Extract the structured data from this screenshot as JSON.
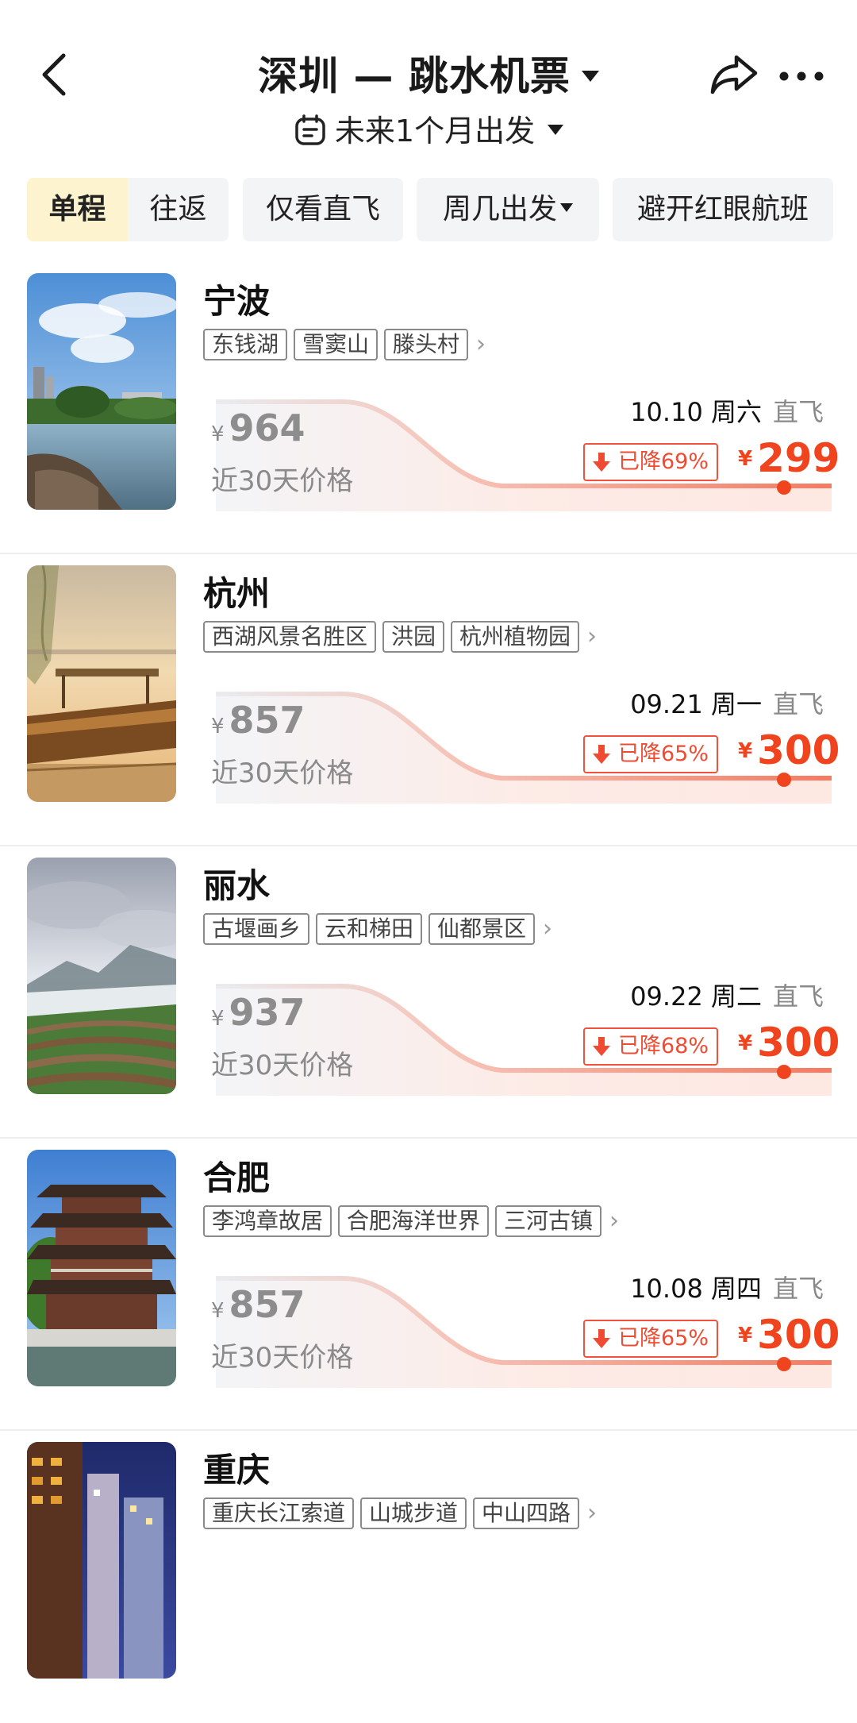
{
  "header": {
    "title": "深圳 — 跳水机票",
    "subtitle": "未来1个月出发"
  },
  "filters": {
    "trip_types": [
      "单程",
      "往返"
    ],
    "active_trip_type": "单程",
    "direct_only": "仅看直飞",
    "weekday": "周几出发",
    "avoid_redeye": "避开红眼航班"
  },
  "list": [
    {
      "city": "宁波",
      "tags": [
        "东钱湖",
        "雪窦山",
        "滕头村"
      ],
      "ref_currency": "¥",
      "ref_price": "964",
      "ref_label": "近30天价格",
      "date": "10.10",
      "weekday": "周六",
      "flight_type": "直飞",
      "drop": "已降69%",
      "currency": "¥",
      "price": "299",
      "image": "lake-landscape"
    },
    {
      "city": "杭州",
      "tags": [
        "西湖风景名胜区",
        "洪园",
        "杭州植物园"
      ],
      "ref_currency": "¥",
      "ref_price": "857",
      "ref_label": "近30天价格",
      "date": "09.21",
      "weekday": "周一",
      "flight_type": "直飞",
      "drop": "已降65%",
      "currency": "¥",
      "price": "300",
      "image": "sunset-boat"
    },
    {
      "city": "丽水",
      "tags": [
        "古堰画乡",
        "云和梯田",
        "仙都景区"
      ],
      "ref_currency": "¥",
      "ref_price": "937",
      "ref_label": "近30天价格",
      "date": "09.22",
      "weekday": "周二",
      "flight_type": "直飞",
      "drop": "已降68%",
      "currency": "¥",
      "price": "300",
      "image": "terraced-fields"
    },
    {
      "city": "合肥",
      "tags": [
        "李鸿章故居",
        "合肥海洋世界",
        "三河古镇"
      ],
      "ref_currency": "¥",
      "ref_price": "857",
      "ref_label": "近30天价格",
      "date": "10.08",
      "weekday": "周四",
      "flight_type": "直飞",
      "drop": "已降65%",
      "currency": "¥",
      "price": "300",
      "image": "pagoda"
    },
    {
      "city": "重庆",
      "tags": [
        "重庆长江索道",
        "山城步道",
        "中山四路"
      ],
      "image": "night-city"
    }
  ],
  "colors": {
    "accent_price": "#f0441f",
    "badge_red": "#ef4b33",
    "active_segment_bg": "#fdf3cf",
    "chip_bg": "#f3f4f6"
  },
  "icons": [
    "back-icon",
    "share-icon",
    "more-icon",
    "calendar-icon",
    "down-arrow-icon",
    "chevron-right-icon"
  ]
}
